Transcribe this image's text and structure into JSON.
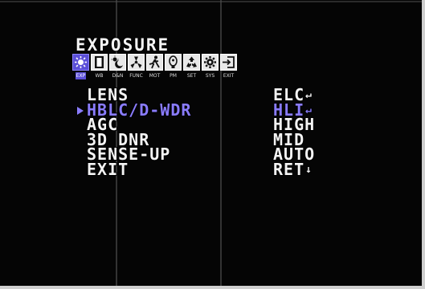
{
  "osd": {
    "title": "EXPOSURE",
    "icons": [
      {
        "name": "exposure-icon",
        "caption": "EXP",
        "selected": true
      },
      {
        "name": "white-balance-icon",
        "caption": "WB",
        "selected": false
      },
      {
        "name": "day-night-icon",
        "caption": "D&N",
        "selected": false
      },
      {
        "name": "function-icon",
        "caption": "FUNC",
        "selected": false
      },
      {
        "name": "motion-icon",
        "caption": "MOT",
        "selected": false
      },
      {
        "name": "privacy-mask-icon",
        "caption": "PM",
        "selected": false
      },
      {
        "name": "setup-icon",
        "caption": "SET",
        "selected": false
      },
      {
        "name": "system-icon",
        "caption": "SYS",
        "selected": false
      },
      {
        "name": "exit-icon",
        "caption": "EXIT",
        "selected": false
      }
    ],
    "items": [
      {
        "label": "LENS",
        "value": "ELC",
        "enter": "↵",
        "selected": false
      },
      {
        "label": "HBLC/D-WDR",
        "value": "HLI",
        "enter": "↵",
        "selected": true
      },
      {
        "label": "AGC",
        "value": "HIGH",
        "enter": "",
        "selected": false
      },
      {
        "label": "3D DNR",
        "value": "MID",
        "enter": "",
        "selected": false
      },
      {
        "label": "SENSE-UP",
        "value": "AUTO",
        "enter": "",
        "selected": false
      },
      {
        "label": "EXIT",
        "value": "RET",
        "enter": "↓",
        "selected": false
      }
    ]
  },
  "colors": {
    "background": "#050505",
    "text": "#f4f4f4",
    "highlight": "#8a7cff",
    "selected_icon": "#5b4fd8"
  }
}
